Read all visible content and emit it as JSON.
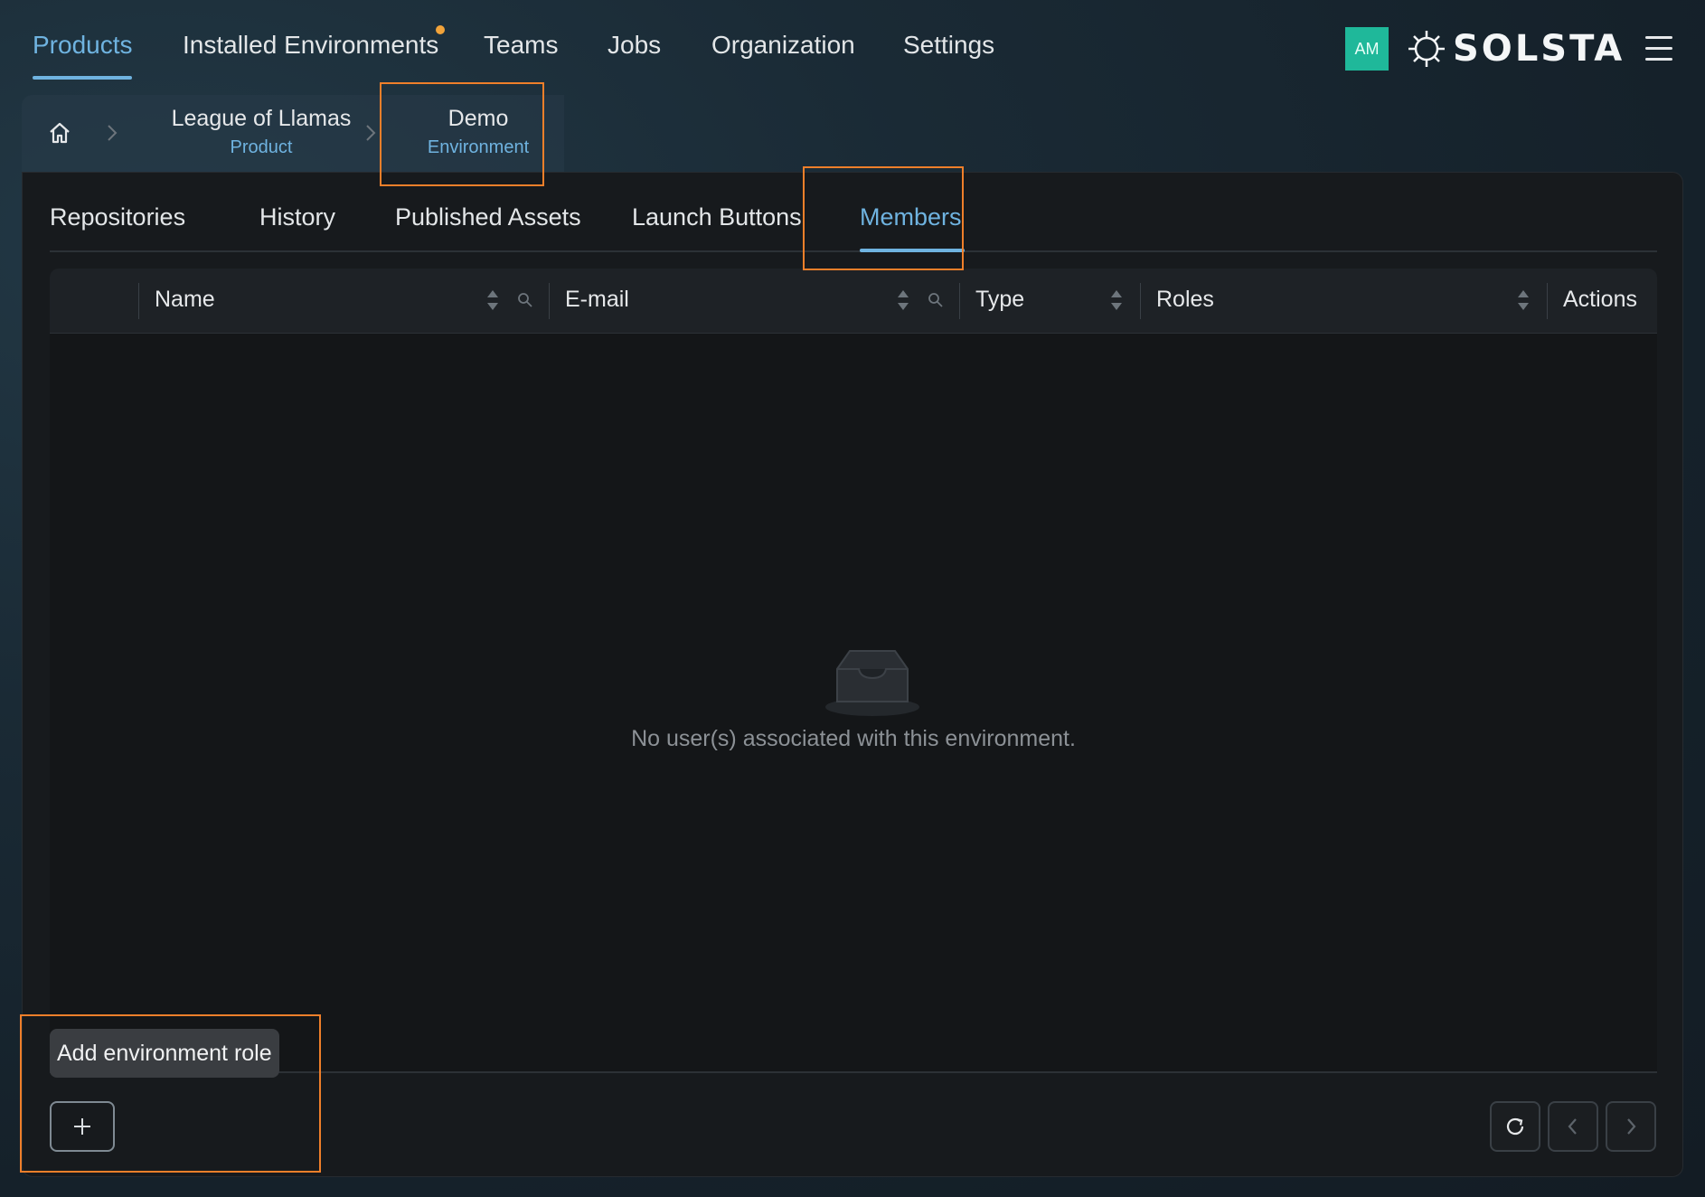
{
  "nav": {
    "items": [
      "Products",
      "Installed Environments",
      "Teams",
      "Jobs",
      "Organization",
      "Settings"
    ],
    "active": "Products"
  },
  "user": {
    "initials": "AM"
  },
  "brand": {
    "name": "SOLSTA"
  },
  "breadcrumb": {
    "product_name": "League of Llamas",
    "product_type": "Product",
    "env_name": "Demo",
    "env_type": "Environment"
  },
  "tabs": {
    "items": [
      "Repositories",
      "History",
      "Published Assets",
      "Launch Buttons",
      "Members"
    ],
    "active": "Members"
  },
  "table": {
    "columns": [
      "Name",
      "E-mail",
      "Type",
      "Roles",
      "Actions"
    ],
    "empty_message": "No user(s) associated with this environment."
  },
  "tooltip": {
    "text": "Add environment role"
  },
  "colors": {
    "accent": "#6fb3e0",
    "annotation": "#ef7f2a",
    "avatar": "#1fb89a"
  }
}
